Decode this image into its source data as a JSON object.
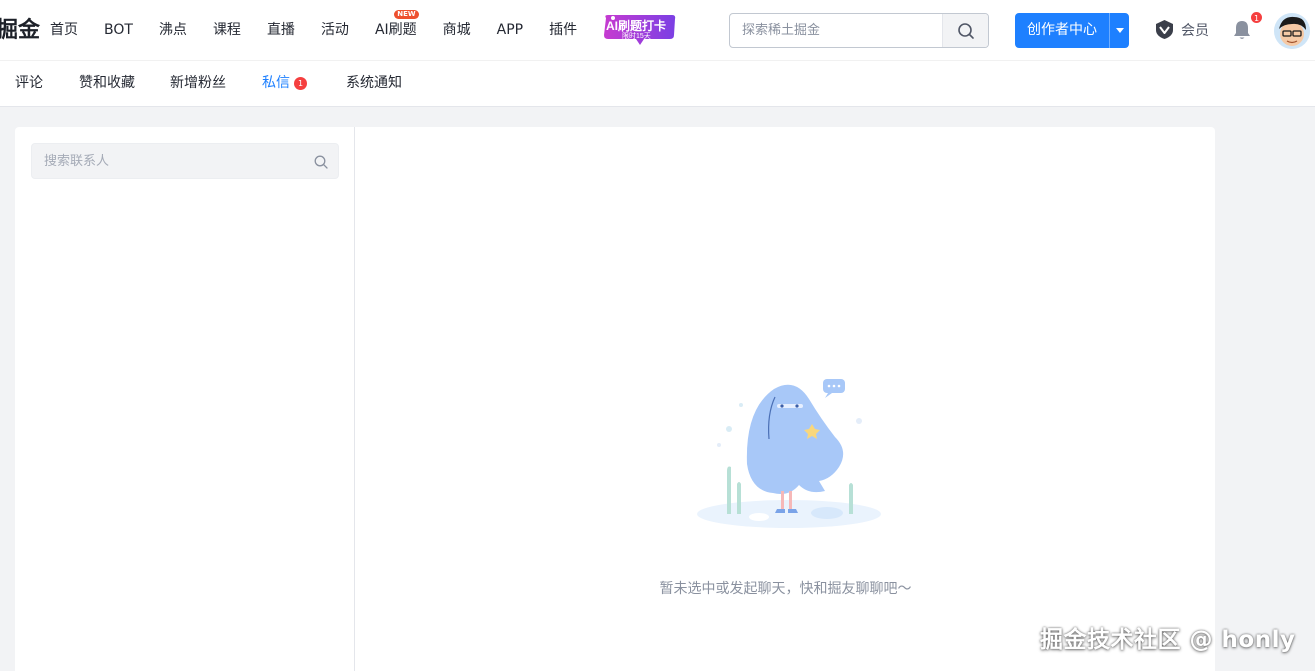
{
  "header": {
    "logo_text": "掘金",
    "nav": [
      {
        "label": "首页"
      },
      {
        "label": "BOT"
      },
      {
        "label": "沸点"
      },
      {
        "label": "课程"
      },
      {
        "label": "直播"
      },
      {
        "label": "活动"
      },
      {
        "label": "AI刷题",
        "badge": "NEW"
      },
      {
        "label": "商城"
      },
      {
        "label": "APP"
      },
      {
        "label": "插件"
      }
    ],
    "promo": {
      "line1": "AI刷题打卡",
      "line2": "限时15天"
    },
    "search": {
      "placeholder": "探索稀土掘金",
      "icon": "search-icon"
    },
    "creator_button": "创作者中心",
    "vip_label": "会员",
    "notification_count": "1"
  },
  "subnav": {
    "items": [
      {
        "label": "评论"
      },
      {
        "label": "赞和收藏"
      },
      {
        "label": "新增粉丝"
      },
      {
        "label": "私信",
        "badge": "1",
        "active": true
      },
      {
        "label": "系统通知"
      }
    ]
  },
  "contacts": {
    "search_placeholder": "搜索联系人"
  },
  "chat": {
    "empty_text": "暂未选中或发起聊天，快和掘友聊聊吧～"
  },
  "watermark": "掘金技术社区 @ honly",
  "colors": {
    "brand": "#1e80ff",
    "badge": "#f53f3f",
    "page_bg": "#f2f3f5",
    "text_primary": "#252933",
    "text_secondary": "#8a919f"
  }
}
